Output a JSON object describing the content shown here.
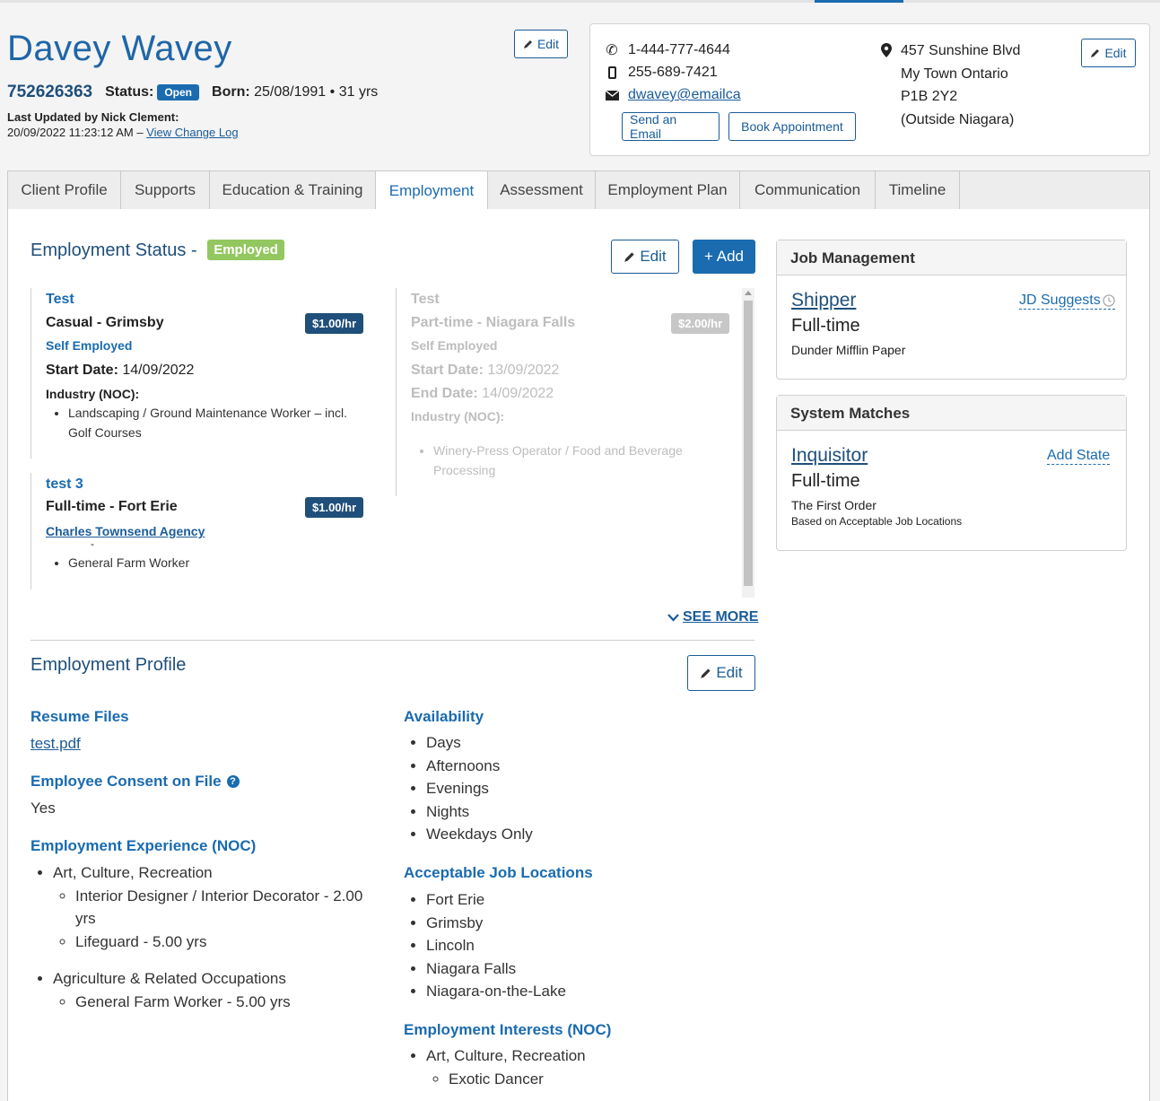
{
  "client": {
    "name": "Davey Wavey",
    "id": "752626363",
    "status_label": "Status:",
    "status": "Open",
    "born_label": "Born:",
    "born": "25/08/1991 • 31 yrs",
    "updated_label": "Last Updated by Nick Clement:",
    "updated_time": "20/09/2022 11:23:12 AM – ",
    "change_log": "View Change Log",
    "edit": "Edit"
  },
  "contact": {
    "phone": "1-444-777-4644",
    "mobile": "255-689-7421",
    "email": "dwavey@emailca",
    "send_email": "Send an Email",
    "book": "Book Appointment",
    "address": [
      "457 Sunshine Blvd",
      "My Town Ontario",
      "P1B 2Y2",
      "(Outside Niagara)"
    ],
    "edit": "Edit"
  },
  "tabs": [
    "Client Profile",
    "Supports",
    "Education & Training",
    "Employment",
    "Assessment",
    "Employment Plan",
    "Communication",
    "Timeline"
  ],
  "status_section": {
    "title": "Employment Status - ",
    "badge": "Employed",
    "edit": "Edit",
    "add": "+ Add",
    "see_more": "SEE MORE"
  },
  "jobs": [
    {
      "title": "Test",
      "type": "Casual - Grimsby",
      "employer": "Self Employed",
      "rate": "$1.00/hr",
      "start_label": "Start Date:",
      "start": "14/09/2022",
      "industry_label": "Industry (NOC):",
      "industry": "Landscaping / Ground Maintenance Worker – incl. Golf Courses"
    },
    {
      "title": "test 3",
      "type": "Full-time - Fort Erie",
      "employer": "Charles Townsend Agency",
      "rate": "$1.00/hr",
      "dash": "-",
      "industry": "General Farm Worker"
    },
    {
      "title": "Test",
      "type": "Part-time - Niagara Falls",
      "employer": "Self Employed",
      "rate": "$2.00/hr",
      "start_label": "Start Date:",
      "start": "13/09/2022",
      "end_label": "End Date:",
      "end": "14/09/2022",
      "industry_label": "Industry (NOC):",
      "industry": "Winery-Press Operator / Food and Beverage Processing"
    }
  ],
  "profile": {
    "title": "Employment Profile",
    "edit": "Edit",
    "resume_label": "Resume Files",
    "resume_file": "test.pdf",
    "consent_label": "Employee Consent on File",
    "consent": "Yes",
    "experience_label": "Employment Experience (NOC)",
    "experience": [
      {
        "group": "Art, Culture, Recreation",
        "items": [
          "Interior Designer / Interior Decorator - 2.00 yrs",
          "Lifeguard - 5.00 yrs"
        ]
      },
      {
        "group": "Agriculture & Related Occupations",
        "items": [
          "General Farm Worker - 5.00 yrs"
        ]
      }
    ],
    "availability_label": "Availability",
    "availability": [
      "Days",
      "Afternoons",
      "Evenings",
      "Nights",
      "Weekdays Only"
    ],
    "locations_label": "Acceptable Job Locations",
    "locations": [
      "Fort Erie",
      "Grimsby",
      "Lincoln",
      "Niagara Falls",
      "Niagara-on-the-Lake"
    ],
    "interests_label": "Employment Interests (NOC)",
    "interests_group": "Art, Culture, Recreation",
    "interests_item": "Exotic Dancer"
  },
  "job_management": {
    "title": "Job Management",
    "job": "Shipper",
    "suggest": "JD Suggests",
    "type": "Full-time",
    "company": "Dunder Mifflin Paper"
  },
  "system_matches": {
    "title": "System Matches",
    "job": "Inquisitor",
    "add_state": "Add State",
    "type": "Full-time",
    "company": "The First Order",
    "note": "Based on Acceptable Job Locations"
  }
}
